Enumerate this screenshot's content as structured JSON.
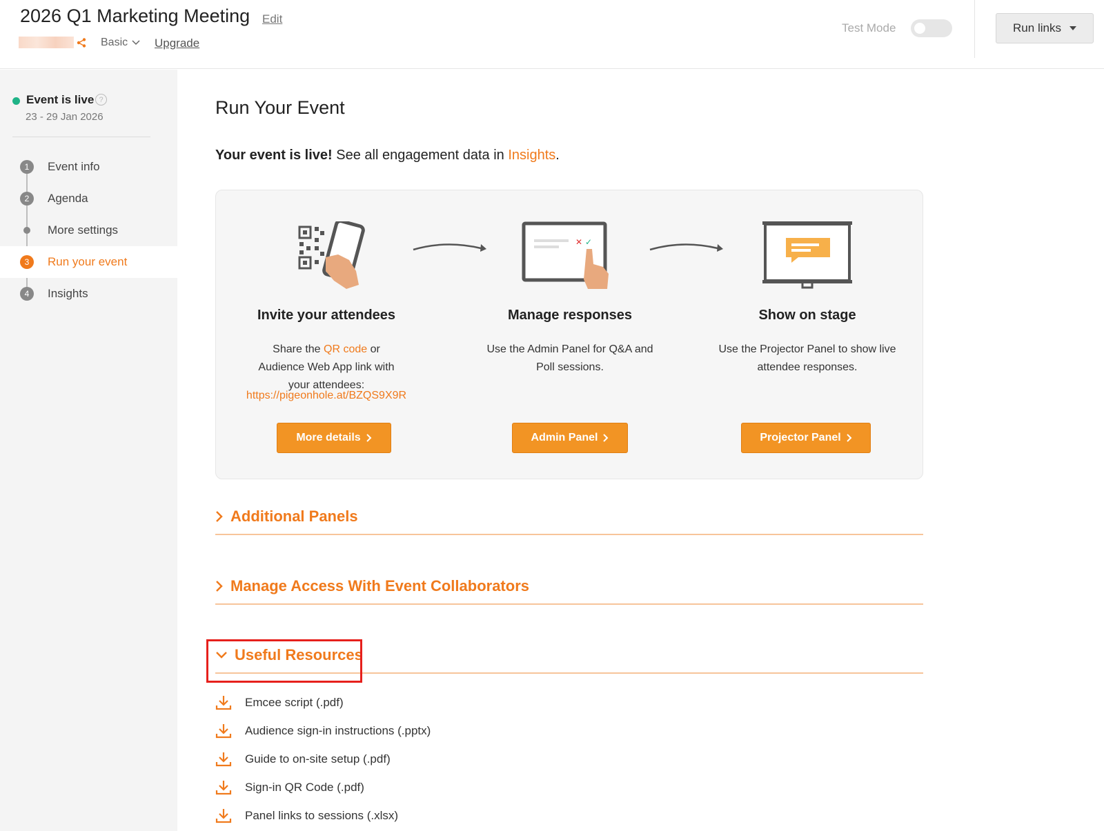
{
  "header": {
    "event_title": "2026 Q1 Marketing Meeting",
    "edit_label": "Edit",
    "plan_label": "Basic",
    "upgrade_label": "Upgrade",
    "test_mode_label": "Test Mode",
    "test_mode_on": false,
    "run_links_label": "Run links"
  },
  "sidebar": {
    "status": "Event is live",
    "help_glyph": "?",
    "dates": "23 - 29 Jan 2026",
    "steps": [
      {
        "num": "1",
        "label": "Event info",
        "active": false
      },
      {
        "num": "2",
        "label": "Agenda",
        "active": false
      },
      {
        "num": "",
        "label": "More settings",
        "active": false
      },
      {
        "num": "3",
        "label": "Run your event",
        "active": true
      },
      {
        "num": "4",
        "label": "Insights",
        "active": false
      }
    ]
  },
  "main": {
    "page_title": "Run Your Event",
    "live_bold": "Your event is live!",
    "live_text": " See all engagement data in ",
    "insights_link": "Insights",
    "live_end": ".",
    "columns": [
      {
        "title": "Invite your attendees",
        "desc_pre": "Share the ",
        "desc_link": "QR code",
        "desc_post": " or Audience Web App link with your attendees:",
        "url": "https://pigeonhole.at/BZQS9X9R",
        "button": "More details"
      },
      {
        "title": "Manage responses",
        "desc": "Use the Admin Panel for Q&A and Poll sessions.",
        "button": "Admin Panel"
      },
      {
        "title": "Show on stage",
        "desc": "Use the Projector Panel to show live attendee responses.",
        "button": "Projector Panel"
      }
    ],
    "sections": [
      {
        "title": "Additional Panels",
        "expanded": false
      },
      {
        "title": "Manage Access With Event Collaborators",
        "expanded": false
      },
      {
        "title": "Useful Resources",
        "expanded": true
      }
    ],
    "resources": [
      "Emcee script (.pdf)",
      "Audience sign-in instructions (.pptx)",
      "Guide to on-site setup (.pdf)",
      "Sign-in QR Code (.pdf)",
      "Panel links to sessions (.xlsx)"
    ]
  },
  "colors": {
    "accent": "#f07a1c",
    "button": "#f29424",
    "live_status": "#1fb387",
    "highlight": "#e6201c"
  },
  "icons": [
    "share-icon",
    "chevron-down-icon",
    "help-icon",
    "chevron-right-icon",
    "download-icon",
    "qr-phone-illustration",
    "tablet-illustration",
    "projector-illustration",
    "arrow-icon"
  ]
}
